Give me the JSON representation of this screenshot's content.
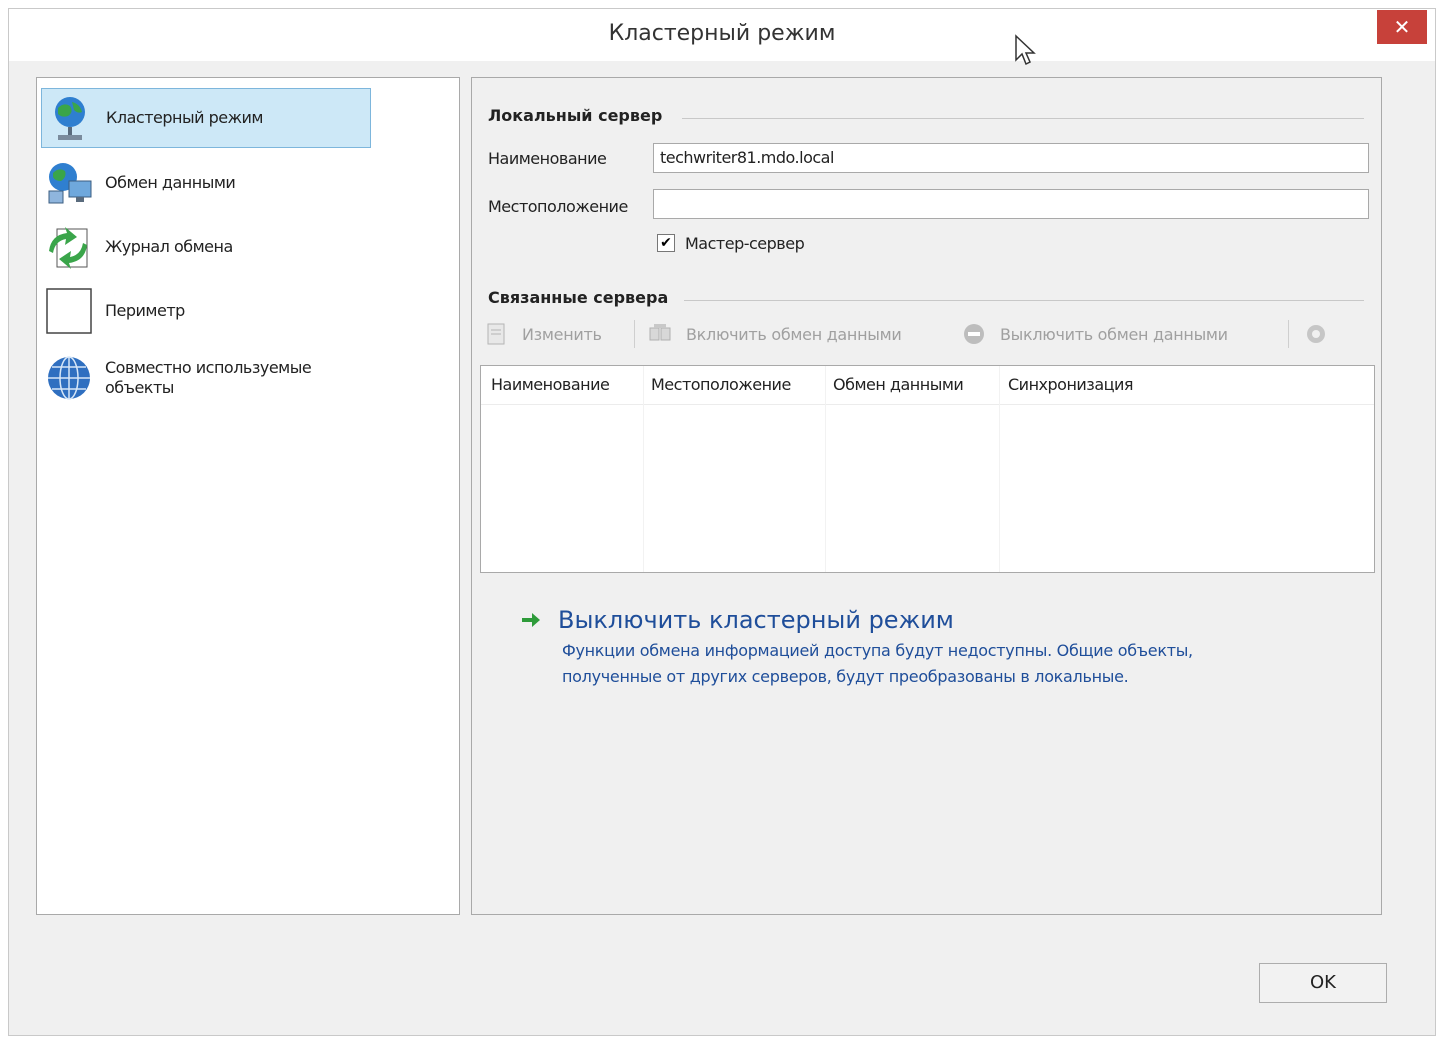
{
  "window": {
    "title": "Кластерный режим",
    "close_label": "✕"
  },
  "nav": {
    "items": [
      {
        "label": "Кластерный режим",
        "icon": "globe-server-icon",
        "selected": true
      },
      {
        "label": "Обмен данными",
        "icon": "data-exchange-icon",
        "selected": false
      },
      {
        "label": "Журнал обмена",
        "icon": "exchange-log-icon",
        "selected": false
      },
      {
        "label": "Периметр",
        "icon": "perimeter-icon",
        "selected": false
      },
      {
        "label": "Совместно используемые объекты",
        "icon": "shared-globe-icon",
        "selected": false
      }
    ]
  },
  "local_server": {
    "group_title": "Локальный сервер",
    "name_label": "Наименование",
    "name_value": "techwriter81.mdo.local",
    "location_label": "Местоположение",
    "location_value": "",
    "master_checkbox_label": "Мастер-сервер",
    "master_checked": true
  },
  "linked_servers": {
    "group_title": "Связанные сервера",
    "toolbar": {
      "edit_label": "Изменить",
      "enable_label": "Включить обмен данными",
      "disable_label": "Выключить обмен данными"
    },
    "columns": [
      "Наименование",
      "Местоположение",
      "Обмен данными",
      "Синхронизация"
    ]
  },
  "cluster_action": {
    "title": "Выключить кластерный режим",
    "description": "Функции обмена информацией доступа будут недоступны. Общие объекты, полученные от других серверов, будут преобразованы в локальные."
  },
  "footer": {
    "ok_label": "OK"
  },
  "colors": {
    "link": "#1f4e9a",
    "selection": "#cde8f7",
    "close": "#c7413a",
    "arrow": "#2e9b3a"
  }
}
